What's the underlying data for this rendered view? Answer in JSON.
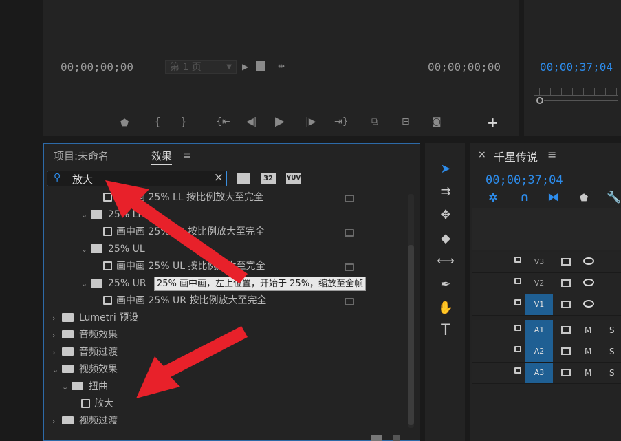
{
  "monitor": {
    "left_timecode": "00;00;00;00",
    "page_select": "第 1 页",
    "right_timecode": "00;00;00;00"
  },
  "program_monitor": {
    "timecode": "00;00;37;04"
  },
  "project_panel": {
    "tab_project": "项目:未命名",
    "tab_effects": "效果",
    "tab_menu": "≡",
    "search_value": "放大",
    "filter_labels": [
      "32",
      "YUV"
    ],
    "tooltip": "25% 画中画，左上位置，开始于 25%，缩放至全帧",
    "tree": [
      {
        "label": "画中画 25% LL 按比例放大至完全",
        "type": "effect",
        "indent": 3
      },
      {
        "label": "25% LR",
        "type": "bin",
        "indent": 2,
        "expanded": true
      },
      {
        "label": "画中画 25% LR 按比例放大至完全",
        "type": "effect",
        "indent": 3
      },
      {
        "label": "25% UL",
        "type": "bin",
        "indent": 2,
        "expanded": true
      },
      {
        "label": "画中画 25% UL 按比例放大至完全",
        "type": "effect",
        "indent": 3
      },
      {
        "label": "25% UR",
        "type": "bin",
        "indent": 2,
        "expanded": true
      },
      {
        "label": "画中画 25% UR 按比例放大至完全",
        "type": "effect",
        "indent": 3
      },
      {
        "label": "Lumetri 预设",
        "type": "bin",
        "indent": 0,
        "expanded": false
      },
      {
        "label": "音频效果",
        "type": "folder",
        "indent": 0,
        "expanded": false
      },
      {
        "label": "音频过渡",
        "type": "folder",
        "indent": 0,
        "expanded": false
      },
      {
        "label": "视频效果",
        "type": "folder",
        "indent": 0,
        "expanded": true
      },
      {
        "label": "扭曲",
        "type": "folder",
        "indent": 1,
        "expanded": true
      },
      {
        "label": "放大",
        "type": "effect",
        "indent": 2
      },
      {
        "label": "视频过渡",
        "type": "folder",
        "indent": 0,
        "expanded": false
      }
    ]
  },
  "timeline": {
    "close": "×",
    "title": "千星传说",
    "menu": "≡",
    "timecode": "00;00;37;04",
    "tracks": [
      {
        "label": "V3",
        "on": false,
        "kind": "video"
      },
      {
        "label": "V2",
        "on": false,
        "kind": "video"
      },
      {
        "label": "V1",
        "on": true,
        "kind": "video"
      },
      {
        "label": "A1",
        "on": true,
        "kind": "audio",
        "m": "M",
        "s": "S"
      },
      {
        "label": "A2",
        "on": true,
        "kind": "audio",
        "m": "M",
        "s": "S"
      },
      {
        "label": "A3",
        "on": true,
        "kind": "audio",
        "m": "M",
        "s": "S"
      }
    ]
  },
  "colors": {
    "accent_blue": "#2d8ceb",
    "annotation_red": "#e8212a",
    "track_on": "#1f5f93"
  }
}
